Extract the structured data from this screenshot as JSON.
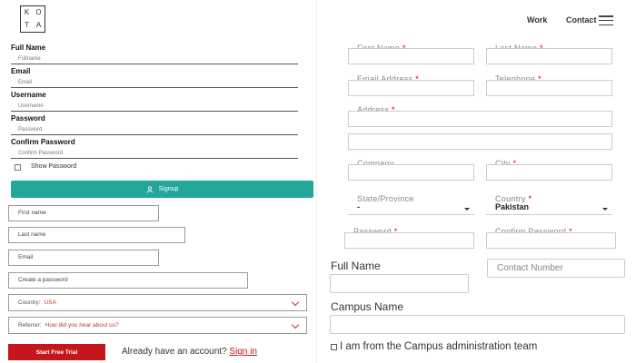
{
  "header": {
    "logo_letters": [
      "K",
      "O",
      "T",
      "A"
    ],
    "nav_work": "Work",
    "nav_contact": "Contact"
  },
  "signup_form": {
    "full_name_label": "Full Name",
    "full_name_placeholder": "Fullname",
    "email_label": "Email",
    "email_placeholder": "Email",
    "username_label": "Username",
    "username_placeholder": "Username",
    "password_label": "Password",
    "password_placeholder": "Password",
    "confirm_label": "Confirm Password",
    "confirm_placeholder": "Confirm Password",
    "show_password": "Show Password",
    "signup_button": "Signup"
  },
  "trial_form": {
    "first_name": "First name",
    "last_name": "Last name",
    "email": "Email",
    "password": "Create a password",
    "country_label": "Country:",
    "country_value": "USA",
    "referrer_label": "Referrer:",
    "referrer_value": "How did you hear about us?",
    "start_button": "Start Free Trial",
    "already_text": "Already have an account?",
    "signin_link": "Sign in"
  },
  "registration_form": {
    "first_name": "First Name",
    "last_name": "Last Name",
    "email": "Email Address",
    "telephone": "Telephone",
    "address": "Address",
    "company": "Company",
    "city": "City",
    "state": "State/Province",
    "state_value": "-",
    "country": "Country",
    "country_value": "Pakistan",
    "password": "Password",
    "confirm_password": "Confirm Password",
    "required_mark": "*"
  },
  "campus_form": {
    "full_name_label": "Full Name",
    "contact_placeholder": "Contact Number",
    "campus_label": "Campus Name",
    "admin_checkbox_label": "I am from the Campus administration team"
  },
  "colors": {
    "signup_teal": "#24a79b",
    "trial_red": "#c4161c"
  }
}
